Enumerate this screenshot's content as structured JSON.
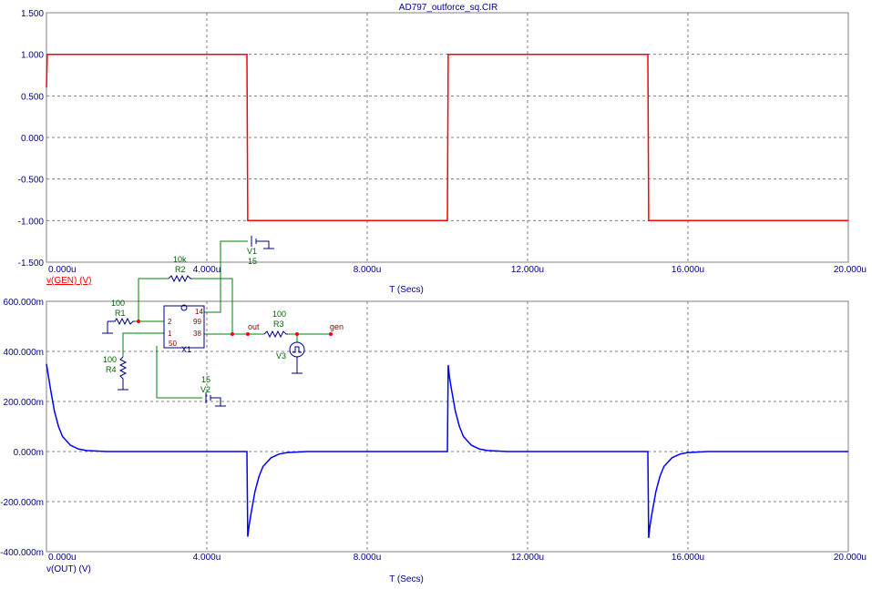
{
  "window_title": "AD797_outforce_sq.CIR",
  "chart_data": [
    {
      "type": "line",
      "id": "top",
      "title": "AD797_outforce_sq.CIR",
      "xlabel": "T (Secs)",
      "ylabel": "v(GEN) (V)",
      "color": "#ff0000",
      "xlim": [
        0,
        20
      ],
      "ylim": [
        -1.5,
        1.5
      ],
      "x_ticks": [
        0,
        4,
        8,
        12,
        16,
        20
      ],
      "x_tick_labels": [
        "0.000u",
        "4.000u",
        "8.000u",
        "12.000u",
        "16.000u",
        "20.000u"
      ],
      "y_ticks": [
        1.5,
        1.0,
        0.5,
        0.0,
        -0.5,
        -1.0,
        -1.5
      ],
      "y_tick_labels": [
        "1.500",
        "1.000",
        "0.500",
        "0.000",
        "-0.500",
        "-1.000",
        "-1.500"
      ],
      "grid": true,
      "series": [
        {
          "name": "v(GEN) (V)",
          "x": [
            0,
            0.02,
            5.0,
            5.02,
            10.0,
            10.02,
            15.0,
            15.02,
            20.0
          ],
          "y": [
            0.6,
            1.0,
            1.0,
            -1.0,
            -1.0,
            1.0,
            1.0,
            -1.0,
            -1.0
          ]
        }
      ]
    },
    {
      "type": "line",
      "id": "bottom",
      "title": "",
      "xlabel": "T (Secs)",
      "ylabel": "v(OUT) (V)",
      "color": "#0000ff",
      "xlim": [
        0,
        20
      ],
      "ylim": [
        -400,
        600
      ],
      "x_ticks": [
        0,
        4,
        8,
        12,
        16,
        20
      ],
      "x_tick_labels": [
        "0.000u",
        "4.000u",
        "8.000u",
        "12.000u",
        "16.000u",
        "20.000u"
      ],
      "y_ticks": [
        600,
        400,
        200,
        0,
        -200,
        -400
      ],
      "y_tick_labels": [
        "600.000m",
        "400.000m",
        "200.000m",
        "0.000m",
        "-200.000m",
        "-400.000m"
      ],
      "grid": true,
      "series": [
        {
          "name": "v(OUT) (V)",
          "x": [
            0,
            0.05,
            0.1,
            0.2,
            0.3,
            0.4,
            0.6,
            0.8,
            1.0,
            1.5,
            5.0,
            5.02,
            5.05,
            5.1,
            5.2,
            5.3,
            5.4,
            5.6,
            5.8,
            6.0,
            6.5,
            10.0,
            10.02,
            10.05,
            10.1,
            10.2,
            10.3,
            10.4,
            10.6,
            10.8,
            11.0,
            11.5,
            15.0,
            15.02,
            15.05,
            15.1,
            15.2,
            15.3,
            15.4,
            15.6,
            15.8,
            16.0,
            16.5,
            20.0
          ],
          "y": [
            350,
            300,
            250,
            160,
            100,
            60,
            25,
            10,
            4,
            0,
            0,
            -340,
            -300,
            -250,
            -160,
            -100,
            -60,
            -25,
            -10,
            -4,
            0,
            0,
            345,
            300,
            250,
            160,
            100,
            60,
            25,
            10,
            4,
            0,
            0,
            -345,
            -300,
            -250,
            -160,
            -100,
            -60,
            -25,
            -10,
            -4,
            0,
            0
          ]
        }
      ]
    }
  ],
  "schematic": {
    "r1": {
      "name": "R1",
      "value": "100"
    },
    "r2": {
      "name": "R2",
      "value": "10k"
    },
    "r3": {
      "name": "R3",
      "value": "100"
    },
    "r4": {
      "name": "R4",
      "value": "100"
    },
    "v1": {
      "name": "V1",
      "value": "15"
    },
    "v2": {
      "name": "V2",
      "value": "15"
    },
    "v3": {
      "name": "V3"
    },
    "x1": {
      "name": "X1",
      "pins": [
        "14",
        "2",
        "99",
        "1",
        "38",
        "50"
      ]
    },
    "nodes": {
      "out": "out",
      "gen": "gen"
    }
  }
}
